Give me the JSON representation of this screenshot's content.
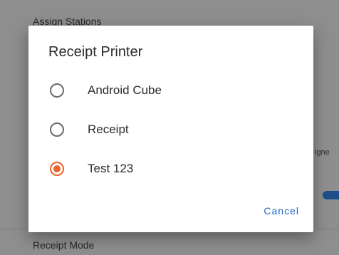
{
  "background": {
    "header": "Assign Stations",
    "side_label": "igne",
    "footer_label": "Receipt Mode"
  },
  "dialog": {
    "title": "Receipt Printer",
    "options": [
      {
        "label": "Android Cube",
        "selected": false
      },
      {
        "label": "Receipt",
        "selected": false
      },
      {
        "label": "Test 123",
        "selected": true
      }
    ],
    "cancel_label": "Cancel"
  },
  "colors": {
    "accent": "#e8652a",
    "button_text": "#1f67c2",
    "toggle": "#1e4f8c"
  }
}
